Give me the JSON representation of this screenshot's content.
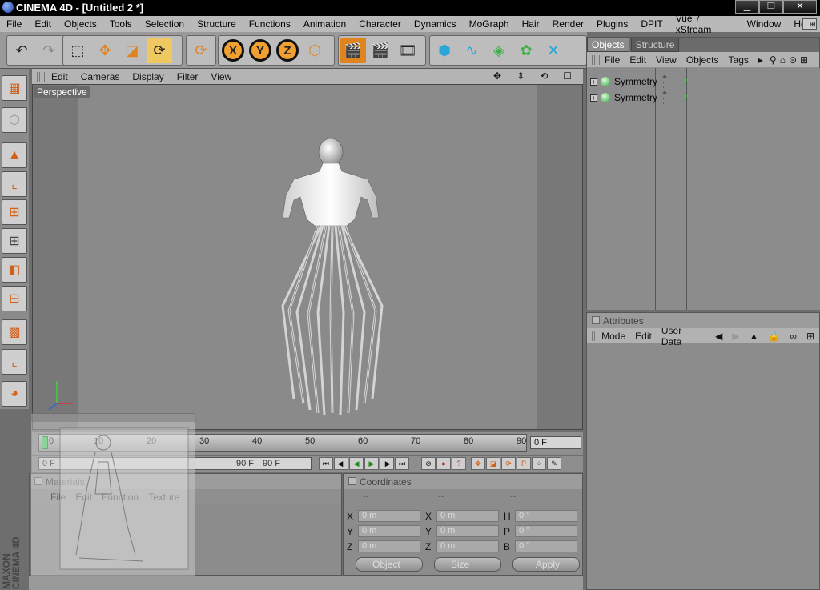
{
  "window": {
    "title": "CINEMA 4D - [Untitled 2 *]",
    "minimize": "▁",
    "restore": "❐",
    "close": "✕"
  },
  "menubar": [
    "File",
    "Edit",
    "Objects",
    "Tools",
    "Selection",
    "Structure",
    "Functions",
    "Animation",
    "Character",
    "Dynamics",
    "MoGraph",
    "Hair",
    "Render",
    "Plugins",
    "DPIT",
    "Vue 7 xStream",
    "Window",
    "Help"
  ],
  "viewport": {
    "menu": [
      "Edit",
      "Cameras",
      "Display",
      "Filter",
      "View"
    ],
    "label": "Perspective"
  },
  "timeline": {
    "ticks": [
      "0",
      "10",
      "20",
      "30",
      "40",
      "50",
      "60",
      "70",
      "80",
      "90"
    ],
    "current_frame": "0 F",
    "start_frame": "0 F",
    "end_marker": "90 F",
    "end_frame": "90 F"
  },
  "objects_panel": {
    "tabs": [
      "Objects",
      "Structure"
    ],
    "menu": [
      "File",
      "Edit",
      "View",
      "Objects",
      "Tags"
    ],
    "items": [
      {
        "name": "Symmetry"
      },
      {
        "name": "Symmetry"
      }
    ]
  },
  "attributes_panel": {
    "title": "Attributes",
    "menu": [
      "Mode",
      "Edit",
      "User Data"
    ]
  },
  "materials_panel": {
    "title": "Materials",
    "menu": [
      "File",
      "Edit",
      "Function",
      "Texture"
    ]
  },
  "coordinates_panel": {
    "title": "Coordinates",
    "col_headers": [
      "--",
      "--",
      "--"
    ],
    "rows": [
      {
        "a_label": "X",
        "a_val": "0 m",
        "b_label": "X",
        "b_val": "0 m",
        "c_label": "H",
        "c_val": "0 °"
      },
      {
        "a_label": "Y",
        "a_val": "0 m",
        "b_label": "Y",
        "b_val": "0 m",
        "c_label": "P",
        "c_val": "0 °"
      },
      {
        "a_label": "Z",
        "a_val": "0 m",
        "b_label": "Z",
        "b_val": "0 m",
        "c_label": "B",
        "c_val": "0 °"
      }
    ],
    "mode_select": "Object",
    "size_select": "Size",
    "apply": "Apply"
  },
  "brand": "MAXON CINEMA 4D",
  "colors": {
    "accent_orange": "#e0841f",
    "toolbar_bg": "#9a9a9a",
    "viewport_bg": "#8a8a8a",
    "check_green": "#2fcf3a"
  }
}
